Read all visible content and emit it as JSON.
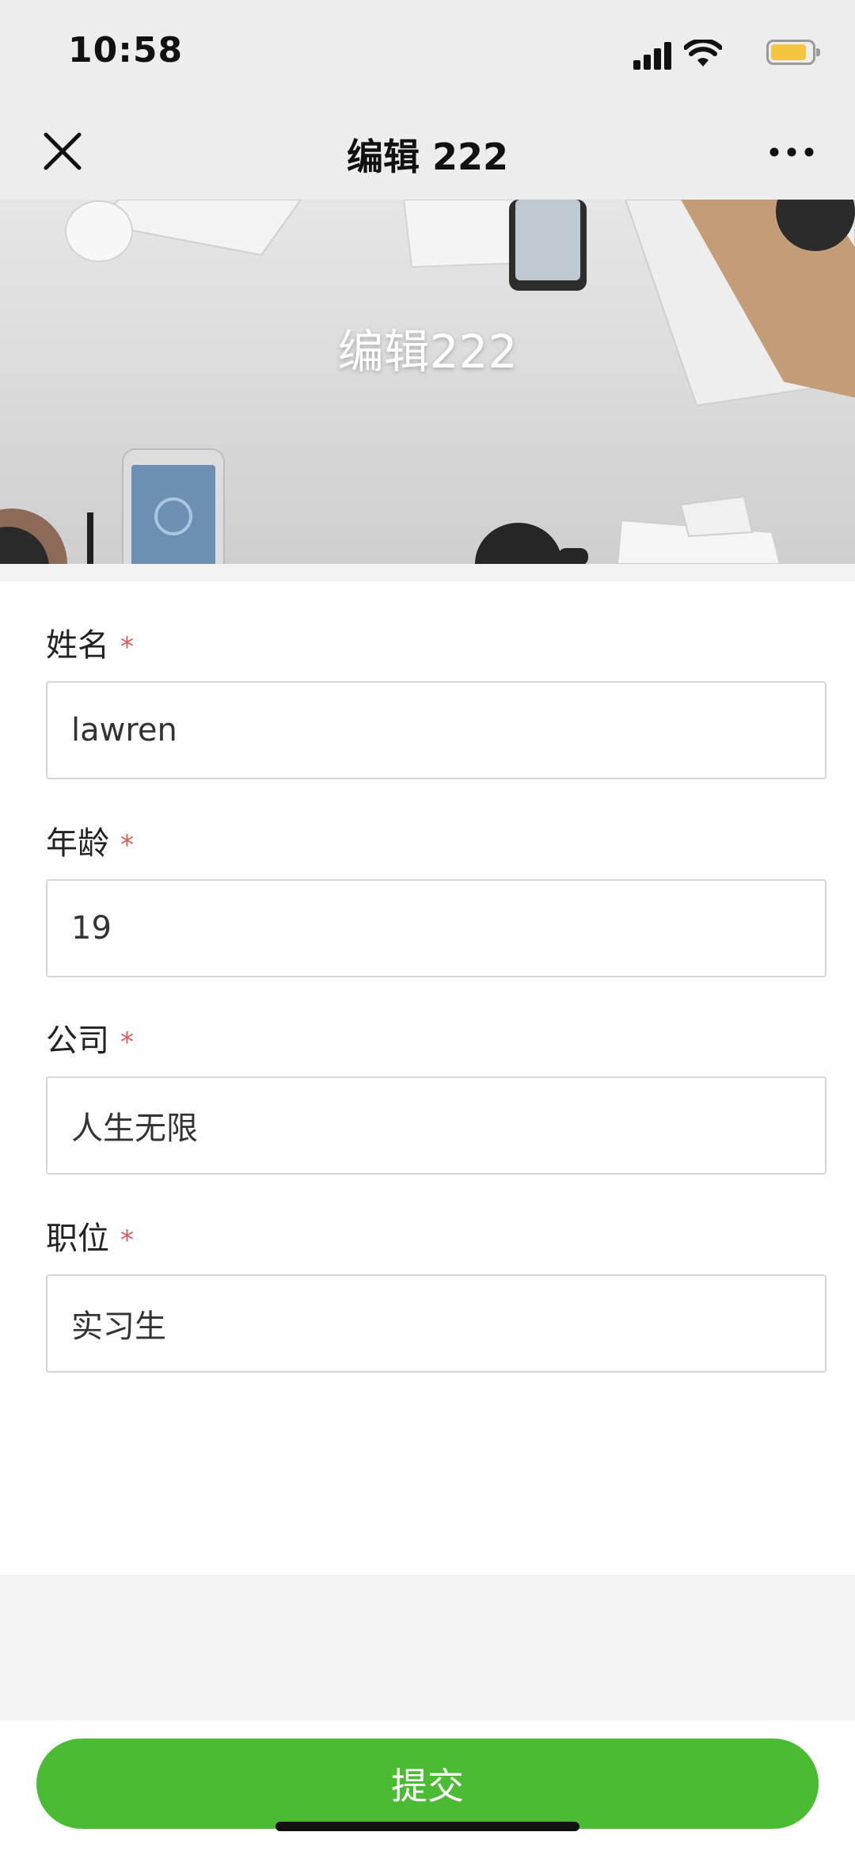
{
  "status_bar": {
    "time": "10:58",
    "battery_color": "#f5c542"
  },
  "nav": {
    "title": "编辑 222",
    "close_icon": "close-icon",
    "more_icon": "more-icon"
  },
  "banner": {
    "title": "编辑222"
  },
  "form": {
    "fields": [
      {
        "label": "姓名",
        "required": "*",
        "value": "lawren"
      },
      {
        "label": "年龄",
        "required": "*",
        "value": "19"
      },
      {
        "label": "公司",
        "required": "*",
        "value": "人生无限"
      },
      {
        "label": "职位",
        "required": "*",
        "value": "实习生"
      }
    ]
  },
  "footer": {
    "submit_label": "提交",
    "accent_color": "#4cbb34"
  }
}
